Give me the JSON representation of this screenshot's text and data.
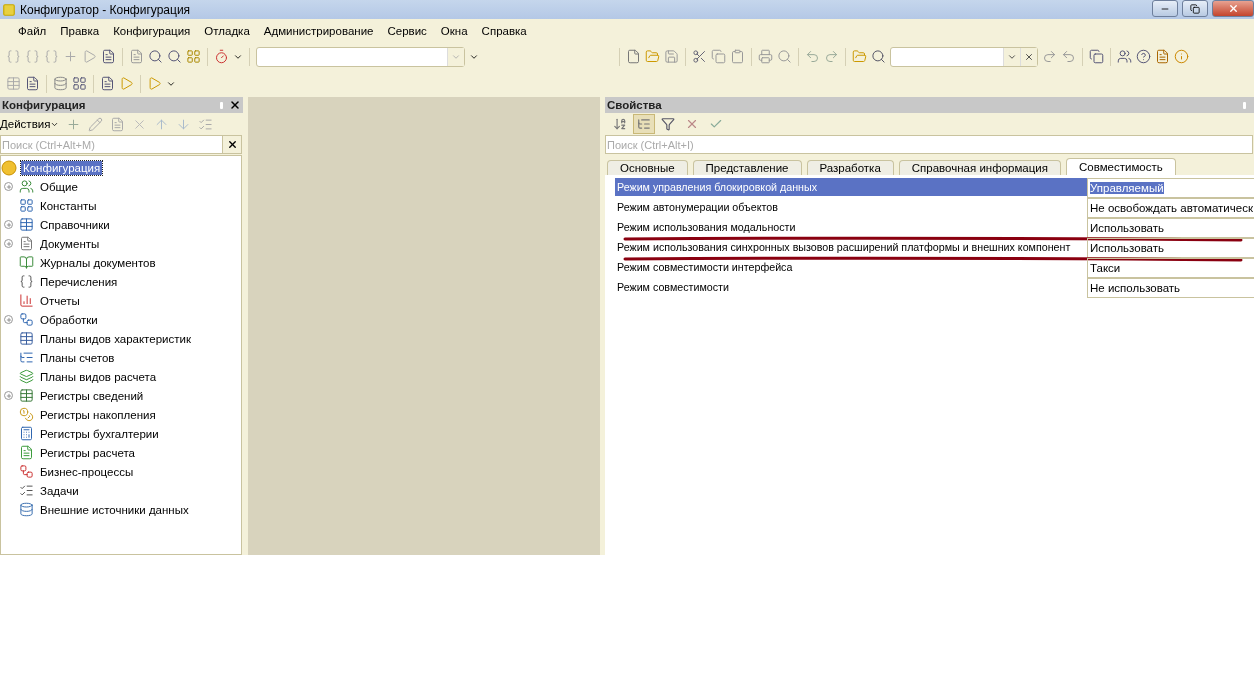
{
  "window": {
    "title": "Конфигуратор - Конфигурация"
  },
  "menu": [
    {
      "label": "Файл"
    },
    {
      "label": "Правка"
    },
    {
      "label": "Конфигурация"
    },
    {
      "label": "Отладка"
    },
    {
      "label": "Администрирование"
    },
    {
      "label": "Сервис"
    },
    {
      "label": "Окна"
    },
    {
      "label": "Справка"
    }
  ],
  "config_panel": {
    "title": "Конфигурация",
    "actions_label": "Действия",
    "search_placeholder": "Поиск (Ctrl+Alt+M)",
    "tree": {
      "label": "Конфигурация",
      "selected": true,
      "children": [
        {
          "label": "Общие",
          "selected": false,
          "expandable": true
        },
        {
          "label": "Константы",
          "selected": false,
          "expandable": false
        },
        {
          "label": "Справочники",
          "selected": false,
          "expandable": true
        },
        {
          "label": "Документы",
          "selected": false,
          "expandable": true
        },
        {
          "label": "Журналы документов",
          "selected": false,
          "expandable": false
        },
        {
          "label": "Перечисления",
          "selected": false,
          "expandable": false
        },
        {
          "label": "Отчеты",
          "selected": false,
          "expandable": false
        },
        {
          "label": "Обработки",
          "selected": false,
          "expandable": true
        },
        {
          "label": "Планы видов характеристик",
          "selected": false,
          "expandable": false
        },
        {
          "label": "Планы счетов",
          "selected": false,
          "expandable": false
        },
        {
          "label": "Планы видов расчета",
          "selected": false,
          "expandable": false
        },
        {
          "label": "Регистры сведений",
          "selected": false,
          "expandable": true
        },
        {
          "label": "Регистры накопления",
          "selected": false,
          "expandable": false
        },
        {
          "label": "Регистры бухгалтерии",
          "selected": false,
          "expandable": false
        },
        {
          "label": "Регистры расчета",
          "selected": false,
          "expandable": false
        },
        {
          "label": "Бизнес-процессы",
          "selected": false,
          "expandable": false
        },
        {
          "label": "Задачи",
          "selected": false,
          "expandable": false
        },
        {
          "label": "Внешние источники данных",
          "selected": false,
          "expandable": false
        }
      ]
    }
  },
  "properties_panel": {
    "title": "Свойства",
    "search_placeholder": "Поиск (Ctrl+Alt+I)",
    "tools": [
      {
        "kind": "sort",
        "pressed": false
      },
      {
        "kind": "tree",
        "pressed": true
      },
      {
        "kind": "filter",
        "pressed": false
      },
      {
        "kind": "cancel",
        "pressed": false
      },
      {
        "kind": "accept",
        "pressed": false
      }
    ],
    "tabs": [
      {
        "label": "Основные",
        "selected": false
      },
      {
        "label": "Представление",
        "selected": false
      },
      {
        "label": "Разработка",
        "selected": false
      },
      {
        "label": "Справочная информация",
        "selected": false
      },
      {
        "label": "Совместимость",
        "selected": true
      }
    ],
    "rows": [
      {
        "name": "Режим управления блокировкой данных",
        "value": "Управляемый",
        "selected": true,
        "underlined": false
      },
      {
        "name": "Режим автонумерации объектов",
        "value": "Не освобождать автоматическ",
        "selected": false,
        "underlined": false
      },
      {
        "name": "Режим использования модальности",
        "value": "Использовать",
        "selected": false,
        "underlined": true
      },
      {
        "name": "Режим использования синхронных вызовов расширений платформы и внешних компонент",
        "value": "Использовать",
        "selected": false,
        "underlined": true
      },
      {
        "name": "Режим совместимости интерфейса",
        "value": "Такси",
        "selected": false,
        "underlined": false
      },
      {
        "name": "Режим совместимости",
        "value": "Не использовать",
        "selected": false,
        "underlined": false
      }
    ]
  }
}
